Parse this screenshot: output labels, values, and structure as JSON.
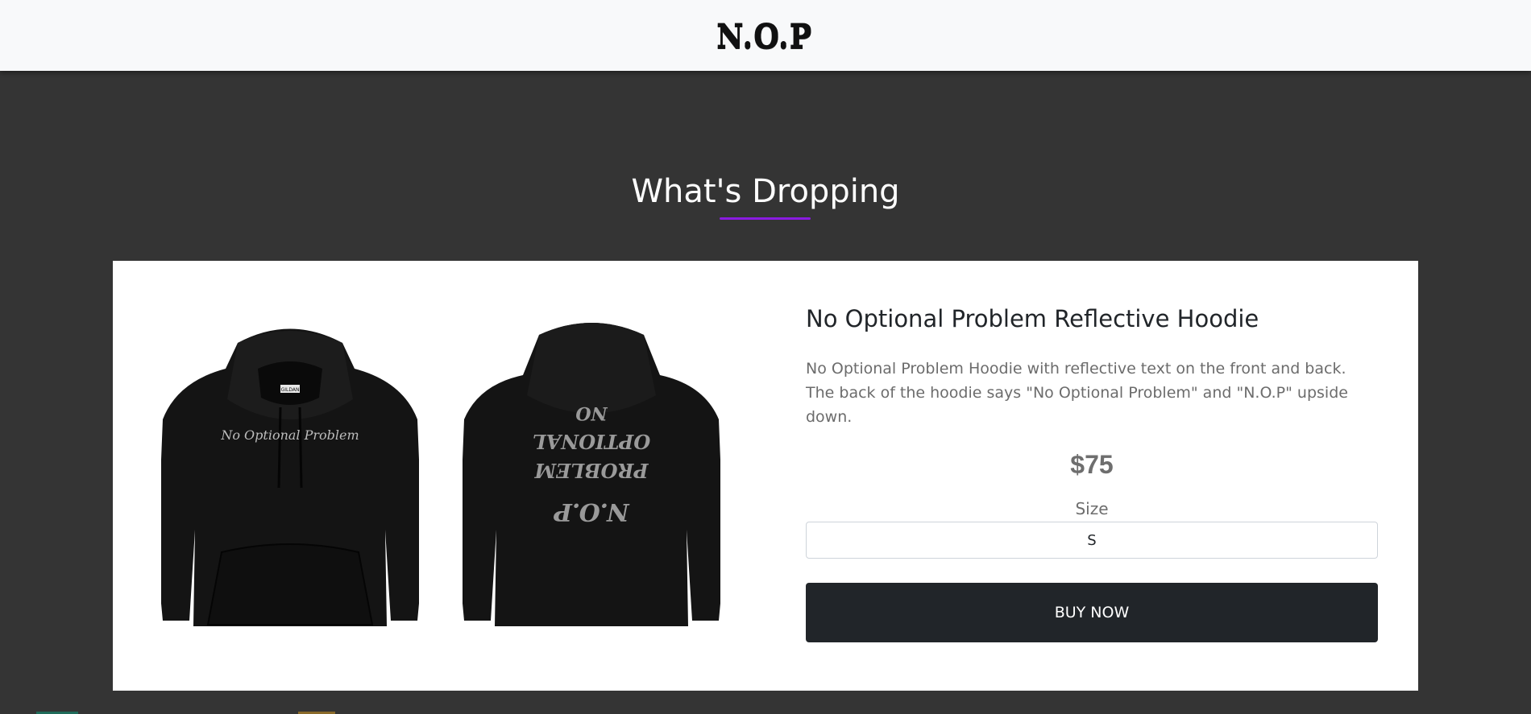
{
  "header": {
    "logo_text": "N.O.P"
  },
  "section": {
    "title": "What's Dropping",
    "accent_color": "#8a1be0"
  },
  "product": {
    "name": "No Optional Problem Reflective Hoodie",
    "description": "No Optional Problem Hoodie with reflective text on the front and back. The back of the hoodie says \"No Optional Problem\" and \"N.O.P\" upside down.",
    "price": "$75",
    "size_label": "Size",
    "size_value": "S",
    "buy_label": "BUY NOW",
    "images": [
      {
        "name": "hoodie-front-image",
        "print_text": "No Optional Problem",
        "tag_text": "GILDAN"
      },
      {
        "name": "hoodie-back-image",
        "print_lines": [
          "N.O.P",
          "PROBLEM",
          "OPTIONAL",
          "NO"
        ]
      }
    ]
  },
  "colors": {
    "page_bg": "#343434",
    "header_bg": "#f8f9fa",
    "card_bg": "#ffffff",
    "button_bg": "#212529"
  }
}
